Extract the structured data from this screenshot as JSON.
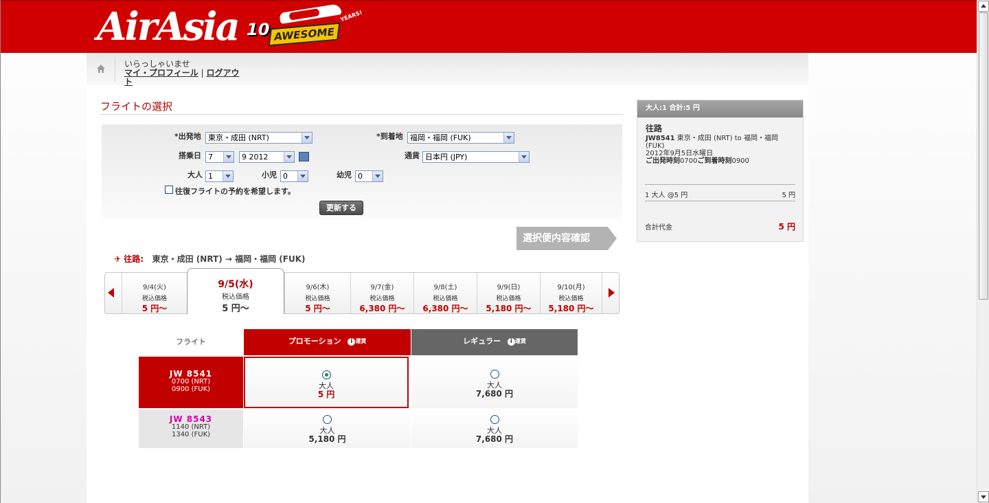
{
  "header": {
    "logo_text": "AirAsia",
    "badge_ten": "10",
    "badge_text": "AWESOME",
    "badge_years": "YEARS!",
    "bg_color": "#d10000"
  },
  "topbar": {
    "welcome": "いらっしゃいませ",
    "profile_link": "マイ・プロフィール",
    "separator": "|",
    "logout_link": "ログアウト",
    "home_icon": "home-icon"
  },
  "page_title": "フライトの選択",
  "search": {
    "origin_label": "*出発地",
    "origin_value": "東京・成田 (NRT)",
    "dest_label": "*到着地",
    "dest_value": "福岡・福岡 (FUK)",
    "date_label": "搭乗日",
    "day_value": "7",
    "month_year_value": "9 2012",
    "currency_label": "通貨",
    "currency_value": "日本円 (JPY)",
    "adult_label": "大人",
    "adult_value": "1",
    "child_label": "小児",
    "child_value": "0",
    "infant_label": "幼児",
    "infant_value": "0",
    "roundtrip_label": "往復フライトの予約を希望します。",
    "update_button": "更新する"
  },
  "confirm_button": "選択便内容確認",
  "route": {
    "label": "往路:",
    "text": "東京・成田 (NRT) → 福岡・福岡 (FUK)"
  },
  "dates": [
    {
      "date": "9/4(火)",
      "tax": "税込価格",
      "price": "5 円〜"
    },
    {
      "date": "9/5(水)",
      "tax": "税込価格",
      "price": "5 円〜",
      "selected": true
    },
    {
      "date": "9/6(木)",
      "tax": "税込価格",
      "price": "5 円〜"
    },
    {
      "date": "9/7(金)",
      "tax": "税込価格",
      "price": "6,380 円〜"
    },
    {
      "date": "9/8(土)",
      "tax": "税込価格",
      "price": "6,380 円〜"
    },
    {
      "date": "9/9(日)",
      "tax": "税込価格",
      "price": "5,180 円〜"
    },
    {
      "date": "9/10(月)",
      "tax": "税込価格",
      "price": "5,180 円〜"
    }
  ],
  "table": {
    "col_flight": "フライト",
    "col_promo": "プロモーション",
    "col_regular": "レギュラー",
    "fare_rules": "運賃",
    "rows": [
      {
        "code": "JW  8541",
        "dep": "0700 (NRT)",
        "arr": "0900 (FUK)",
        "promo_pax": "大人",
        "promo_price": "5 円",
        "reg_pax": "大人",
        "reg_price": "7,680 円"
      },
      {
        "code": "JW  8543",
        "dep": "1140 (NRT)",
        "arr": "1340 (FUK)",
        "promo_pax": "大人",
        "promo_price": "5,180 円",
        "reg_pax": "大人",
        "reg_price": "7,680 円"
      }
    ]
  },
  "summary": {
    "header": "大人:1  合計:5 円",
    "outbound": "往路",
    "flight_code": "JW8541",
    "flight_route": " 東京・成田 (NRT) to 福岡・福岡 (FUK)",
    "flight_date": "2012年9月5日水曜日",
    "dep_label": "ご出発時刻",
    "dep_time": "0700",
    "arr_label": "ご到着時刻",
    "arr_time": "0900",
    "pax_line": "1 大人 @5 円",
    "pax_amount": "5 円",
    "total_label": "合計代金",
    "total_value": "5 円"
  }
}
